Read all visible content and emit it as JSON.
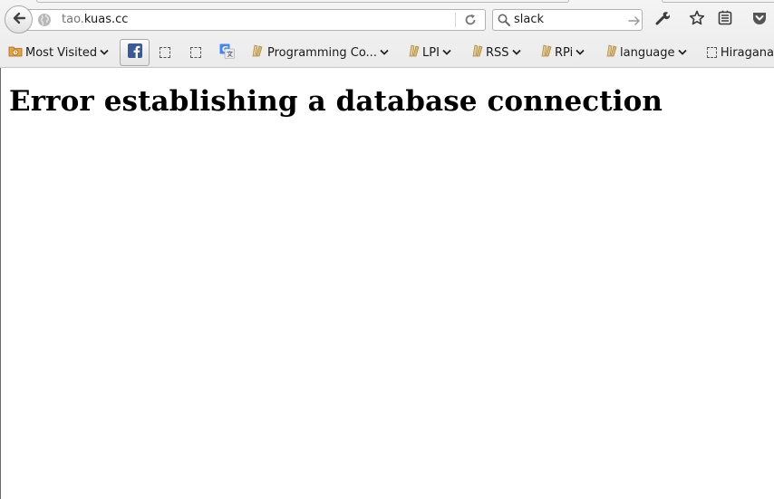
{
  "navbar": {
    "url_subdomain": "tao.",
    "url_domain": "kuas.cc",
    "search_value": "slack"
  },
  "bookmarks": {
    "most_visited": "Most Visited",
    "programming": "Programming Co...",
    "lpi": "LPI",
    "rss": "RSS",
    "rpi": "RPi",
    "language": "language",
    "hiragana": "Hiragana"
  },
  "page": {
    "heading": "Error establishing a database connection"
  },
  "icons": {
    "back": "back-arrow-icon",
    "site_identity": "globe-icon",
    "reload": "reload-icon",
    "search": "search-icon",
    "go": "go-arrow-icon",
    "tools": "wrench-icon",
    "bookmark_star": "star-icon",
    "reading_list": "reading-list-icon",
    "pocket": "pocket-icon",
    "facebook": "facebook-icon",
    "translate": "google-translate-icon",
    "folder": "folder-icon"
  },
  "colors": {
    "facebook": "#3b5998",
    "folder": "#d8b66a",
    "pocket": "#555555"
  }
}
